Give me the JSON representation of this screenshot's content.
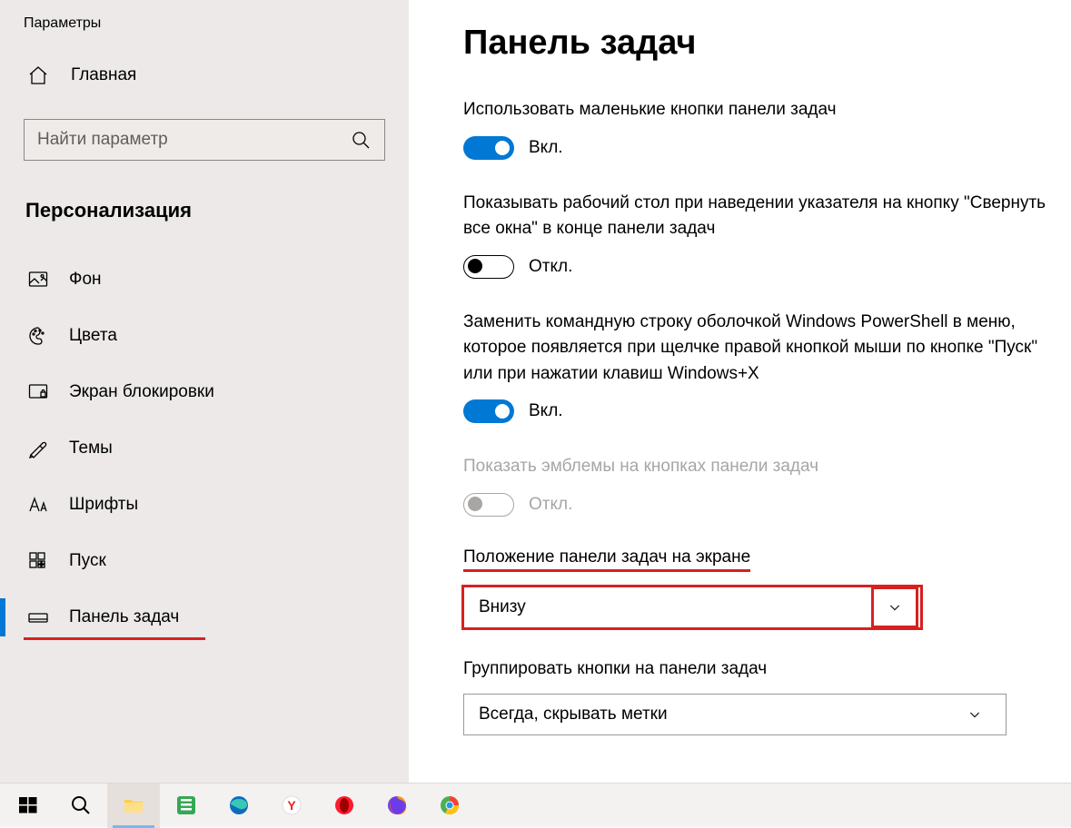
{
  "window_title": "Параметры",
  "sidebar": {
    "home_label": "Главная",
    "search_placeholder": "Найти параметр",
    "category": "Персонализация",
    "items": [
      {
        "label": "Фон"
      },
      {
        "label": "Цвета"
      },
      {
        "label": "Экран блокировки"
      },
      {
        "label": "Темы"
      },
      {
        "label": "Шрифты"
      },
      {
        "label": "Пуск"
      },
      {
        "label": "Панель задач"
      }
    ]
  },
  "page": {
    "title": "Панель задач",
    "settings": {
      "small_buttons": {
        "text": "Использовать маленькие кнопки панели задач",
        "state": "Вкл."
      },
      "peek_desktop": {
        "text": "Показывать рабочий стол при наведении указателя на кнопку \"Свернуть все окна\" в конце панели задач",
        "state": "Откл."
      },
      "powershell": {
        "text": "Заменить командную строку оболочкой Windows PowerShell в меню, которое появляется при щелчке правой кнопкой мыши по кнопке \"Пуск\" или при нажатии клавиш Windows+X",
        "state": "Вкл."
      },
      "badges": {
        "text": "Показать эмблемы на кнопках панели задач",
        "state": "Откл."
      },
      "position": {
        "label": "Положение панели задач на экране",
        "value": "Внизу"
      },
      "combine": {
        "label": "Группировать кнопки на панели задач",
        "value": "Всегда, скрывать метки"
      }
    }
  },
  "taskbar_icons": [
    "start",
    "search",
    "explorer",
    "app-green",
    "edge",
    "yandex",
    "opera",
    "firefox",
    "chrome"
  ]
}
